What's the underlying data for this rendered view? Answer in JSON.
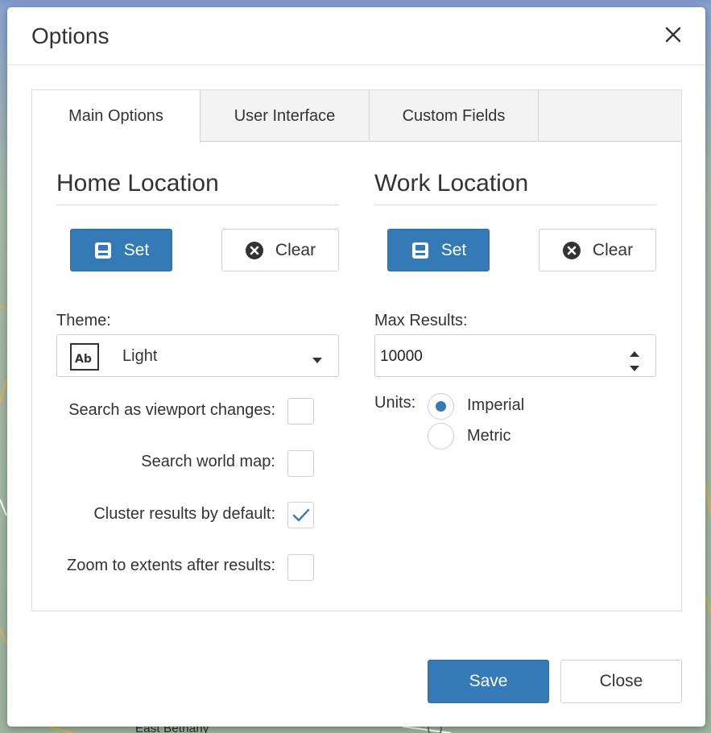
{
  "map": {
    "place_label": "East Bethany"
  },
  "dialog": {
    "title": "Options",
    "close_icon": "close-icon"
  },
  "tabs": [
    {
      "label": "Main Options",
      "active": true
    },
    {
      "label": "User Interface",
      "active": false
    },
    {
      "label": "Custom Fields",
      "active": false
    }
  ],
  "home": {
    "title": "Home Location",
    "set_label": "Set",
    "set_icon": "save-icon",
    "clear_label": "Clear",
    "clear_icon": "clear-circle-icon"
  },
  "work": {
    "title": "Work Location",
    "set_label": "Set",
    "set_icon": "save-icon",
    "clear_label": "Clear",
    "clear_icon": "clear-circle-icon"
  },
  "theme": {
    "label": "Theme:",
    "value": "Light",
    "icon": "text-style-icon"
  },
  "max_results": {
    "label": "Max Results:",
    "value": "10000"
  },
  "units": {
    "label": "Units:",
    "options": [
      {
        "label": "Imperial",
        "selected": true
      },
      {
        "label": "Metric",
        "selected": false
      }
    ]
  },
  "checkboxes": [
    {
      "label": "Search as viewport changes:",
      "checked": false
    },
    {
      "label": "Search world map:",
      "checked": false
    },
    {
      "label": "Cluster results by default:",
      "checked": true
    },
    {
      "label": "Zoom to extents after results:",
      "checked": false
    }
  ],
  "footer": {
    "save_label": "Save",
    "close_label": "Close"
  },
  "colors": {
    "primary": "#337ab7",
    "primary_border": "#2e6da4",
    "border": "#cfcfcf"
  }
}
